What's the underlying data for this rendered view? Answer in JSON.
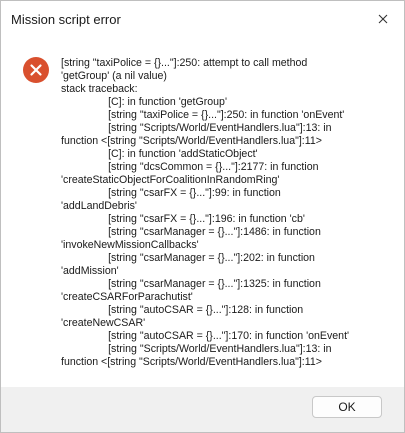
{
  "window": {
    "title": "Mission script error",
    "close_icon": "close-icon"
  },
  "dialog": {
    "icon": "error-icon",
    "icon_color": "#d9502e",
    "message_lines": [
      "[string \"taxiPolice = {}...\"]:250: attempt to call method",
      "'getGroup' (a nil value)",
      "stack traceback:",
      "                [C]: in function 'getGroup'",
      "                [string \"taxiPolice = {}...\"]:250: in function 'onEvent'",
      "                [string \"Scripts/World/EventHandlers.lua\"]:13: in",
      "function <[string \"Scripts/World/EventHandlers.lua\"]:11>",
      "                [C]: in function 'addStaticObject'",
      "                [string \"dcsCommon = {}...\"]:2177: in function",
      "'createStaticObjectForCoalitionInRandomRing'",
      "                [string \"csarFX = {}...\"]:99: in function",
      "'addLandDebris'",
      "                [string \"csarFX = {}...\"]:196: in function 'cb'",
      "                [string \"csarManager = {}...\"]:1486: in function",
      "'invokeNewMissionCallbacks'",
      "                [string \"csarManager = {}...\"]:202: in function",
      "'addMission'",
      "                [string \"csarManager = {}...\"]:1325: in function",
      "'createCSARForParachutist'",
      "                [string \"autoCSAR = {}...\"]:128: in function",
      "'createNewCSAR'",
      "                [string \"autoCSAR = {}...\"]:170: in function 'onEvent'",
      "                [string \"Scripts/World/EventHandlers.lua\"]:13: in",
      "function <[string \"Scripts/World/EventHandlers.lua\"]:11>"
    ]
  },
  "footer": {
    "ok_label": "OK"
  }
}
